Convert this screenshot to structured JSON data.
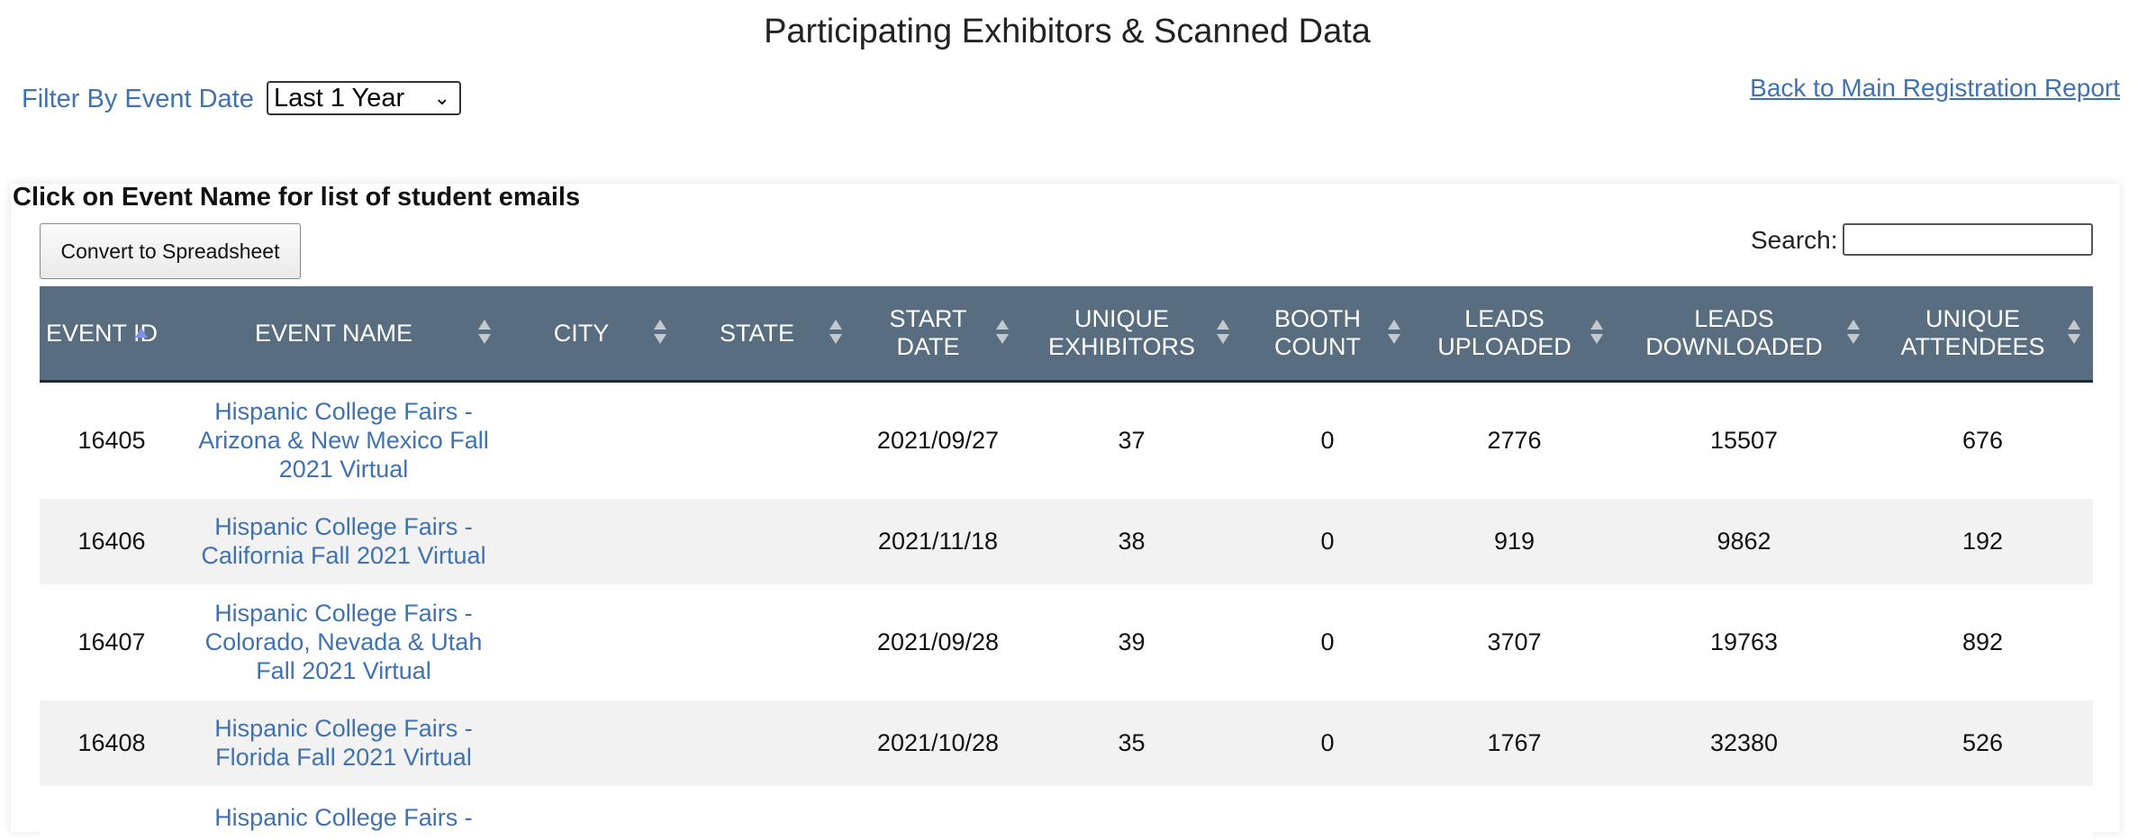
{
  "header": {
    "title": "Participating Exhibitors & Scanned Data",
    "back_link": "Back to Main Registration Report"
  },
  "filter": {
    "label": "Filter By Event Date",
    "selected": "Last 1 Year"
  },
  "panel": {
    "instructions": "Click on Event Name for list of student emails",
    "convert_button": "Convert to Spreadsheet",
    "search_label": "Search:",
    "search_value": ""
  },
  "table": {
    "columns": [
      {
        "label": "EVENT ID",
        "sort": "ascending"
      },
      {
        "label": "EVENT NAME",
        "sort": "none"
      },
      {
        "label": "CITY",
        "sort": "none"
      },
      {
        "label": "STATE",
        "sort": "none"
      },
      {
        "label": "START DATE",
        "sort": "none"
      },
      {
        "label": "UNIQUE EXHIBITORS",
        "sort": "none"
      },
      {
        "label": "BOOTH COUNT",
        "sort": "none"
      },
      {
        "label": "LEADS UPLOADED",
        "sort": "none"
      },
      {
        "label": "LEADS DOWNLOADED",
        "sort": "none"
      },
      {
        "label": "UNIQUE ATTENDEES",
        "sort": "none"
      }
    ],
    "rows": [
      {
        "event_id": "16405",
        "event_name": "Hispanic College Fairs - Arizona & New Mexico Fall 2021 Virtual",
        "city": "",
        "state": "",
        "start_date": "2021/09/27",
        "unique_exhibitors": "37",
        "booth_count": "0",
        "leads_uploaded": "2776",
        "leads_downloaded": "15507",
        "unique_attendees": "676"
      },
      {
        "event_id": "16406",
        "event_name": "Hispanic College Fairs - California Fall 2021 Virtual",
        "city": "",
        "state": "",
        "start_date": "2021/11/18",
        "unique_exhibitors": "38",
        "booth_count": "0",
        "leads_uploaded": "919",
        "leads_downloaded": "9862",
        "unique_attendees": "192"
      },
      {
        "event_id": "16407",
        "event_name": "Hispanic College Fairs - Colorado, Nevada & Utah Fall 2021 Virtual",
        "city": "",
        "state": "",
        "start_date": "2021/09/28",
        "unique_exhibitors": "39",
        "booth_count": "0",
        "leads_uploaded": "3707",
        "leads_downloaded": "19763",
        "unique_attendees": "892"
      },
      {
        "event_id": "16408",
        "event_name": "Hispanic College Fairs - Florida Fall 2021 Virtual",
        "city": "",
        "state": "",
        "start_date": "2021/10/28",
        "unique_exhibitors": "35",
        "booth_count": "0",
        "leads_uploaded": "1767",
        "leads_downloaded": "32380",
        "unique_attendees": "526"
      },
      {
        "event_id": "",
        "event_name": "Hispanic College Fairs -",
        "city": "",
        "state": "",
        "start_date": "",
        "unique_exhibitors": "",
        "booth_count": "",
        "leads_uploaded": "",
        "leads_downloaded": "",
        "unique_attendees": ""
      }
    ]
  },
  "colors": {
    "link": "#3f72af",
    "header_bg": "#586d7f",
    "header_border": "#1f2b35",
    "stripe": "#f2f2f2",
    "sort_active": "#7d8fe6",
    "sort_idle": "#c4c9cf"
  }
}
